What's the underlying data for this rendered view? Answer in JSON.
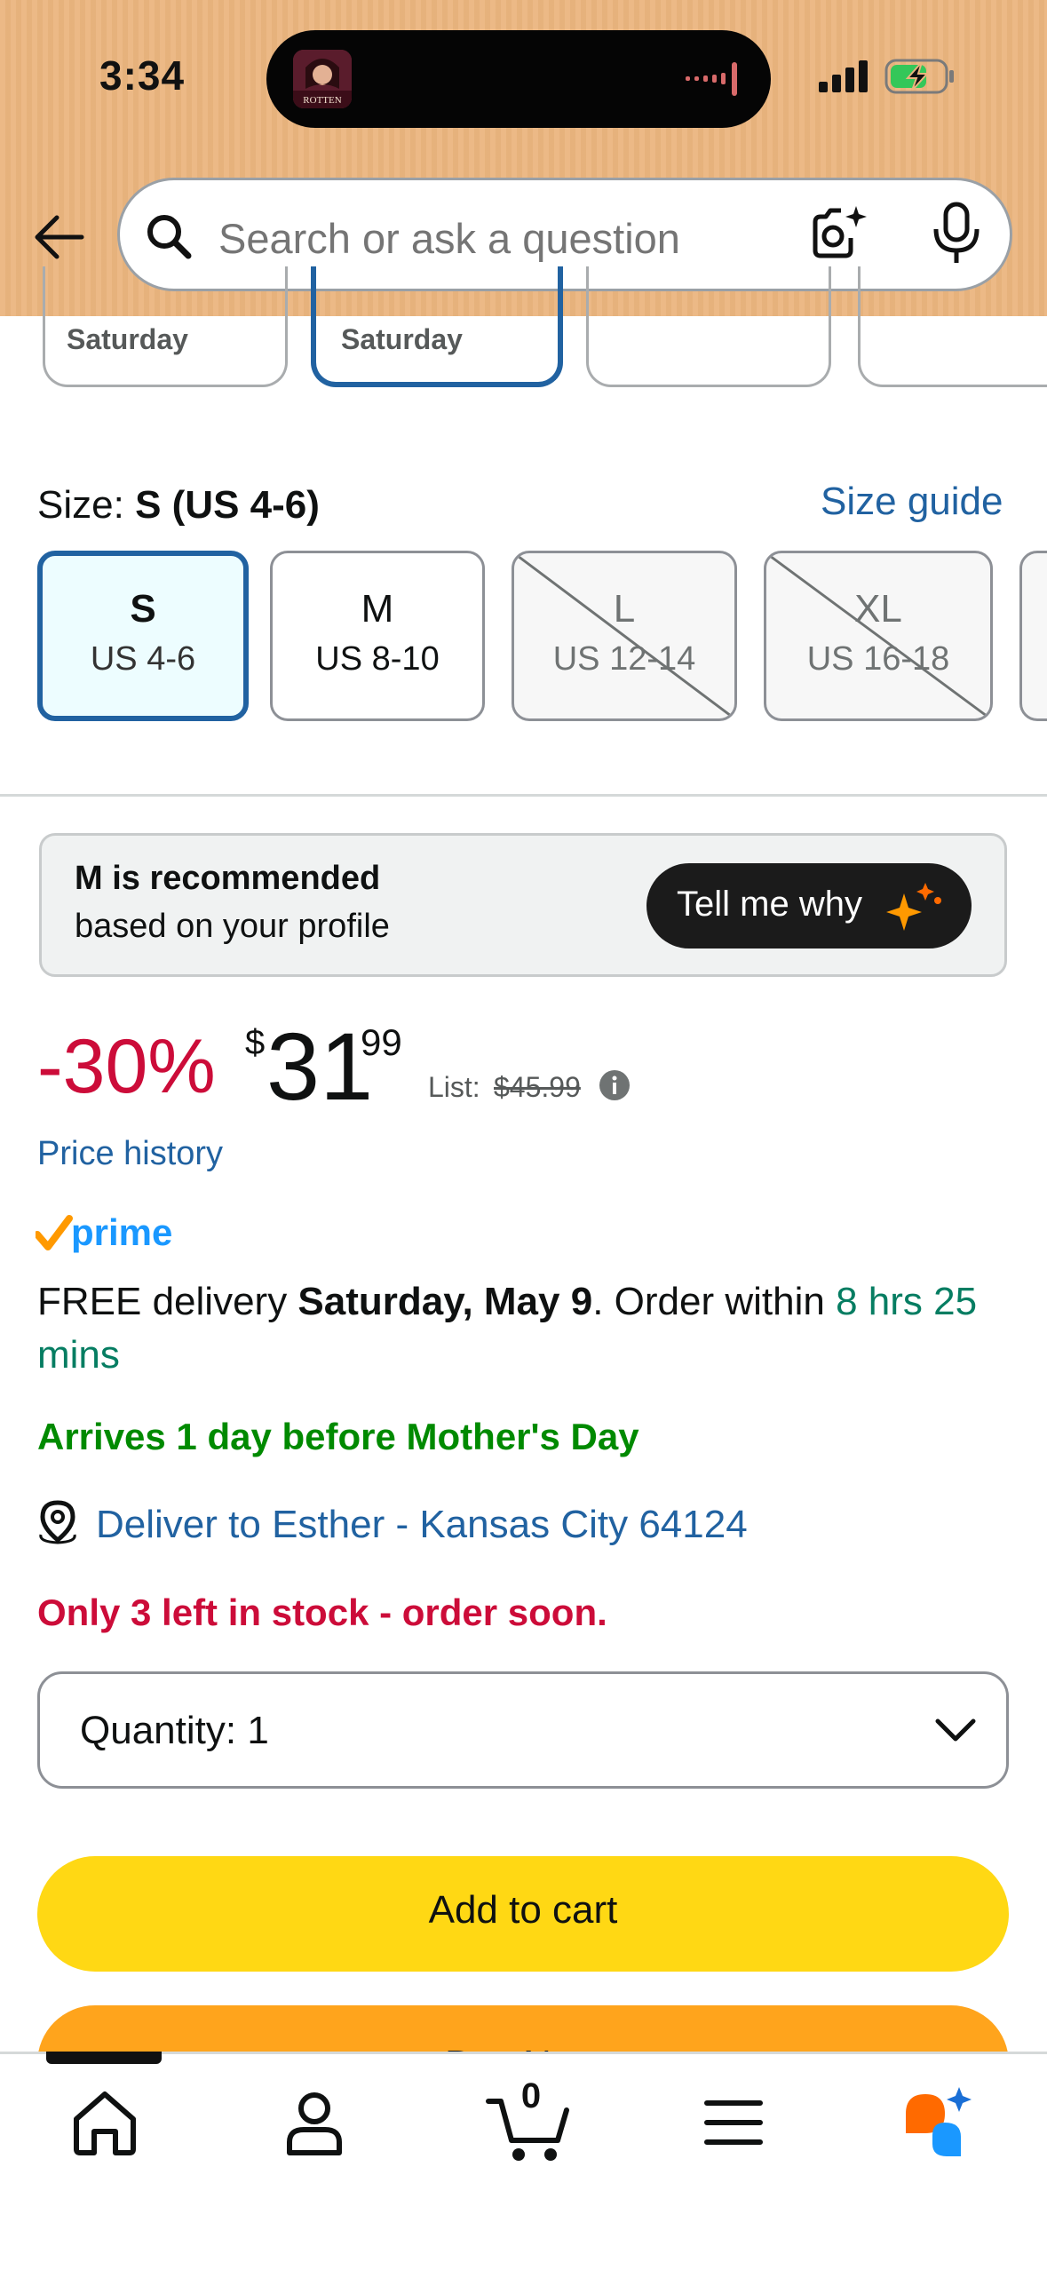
{
  "status_bar": {
    "time": "3:34"
  },
  "island": {
    "thumb_text": "ROTTEN"
  },
  "header": {
    "search_placeholder": "Search or ask a question"
  },
  "delivery_tiles": [
    {
      "label": "Saturday",
      "selected": false
    },
    {
      "label": "Saturday",
      "selected": true
    },
    {
      "label": "",
      "selected": false
    },
    {
      "label": "",
      "selected": false
    }
  ],
  "size": {
    "heading_prefix": "Size:",
    "selected_value": "S (US 4-6)",
    "guide_link": "Size guide",
    "options": [
      {
        "size": "S",
        "us": "US 4-6",
        "state": "selected"
      },
      {
        "size": "M",
        "us": "US 8-10",
        "state": "available"
      },
      {
        "size": "L",
        "us": "US 12-14",
        "state": "unavailable"
      },
      {
        "size": "XL",
        "us": "US 16-18",
        "state": "unavailable"
      }
    ]
  },
  "recommendation": {
    "title": "M is recommended",
    "subtitle": "based on your profile",
    "button": "Tell me why"
  },
  "price": {
    "discount": "-30%",
    "currency": "$",
    "whole": "31",
    "fraction": "99",
    "list_label": "List:",
    "list_price": "$45.99",
    "history_link": "Price history"
  },
  "delivery": {
    "prime": "prime",
    "prefix": "FREE delivery ",
    "date": "Saturday, May 9",
    "middle": ". Order within ",
    "countdown": "8 hrs 25 mins",
    "arrives": "Arrives 1 day before Mother's Day",
    "deliver_to": "Deliver to Esther - Kansas City 64124",
    "stock": "Only 3 left in stock - order soon."
  },
  "quantity": {
    "label": "Quantity:",
    "value": "1"
  },
  "buttons": {
    "add_to_cart": "Add to cart",
    "buy_now": "Buy Now"
  },
  "nav": {
    "cart_count": "0"
  },
  "colors": {
    "header_bg": "#ebb57e",
    "link_blue": "#2162a1",
    "deal_red": "#cc0c39",
    "green": "#008a00",
    "add_to_cart": "#ffd814",
    "buy_now": "#ffa41c"
  }
}
